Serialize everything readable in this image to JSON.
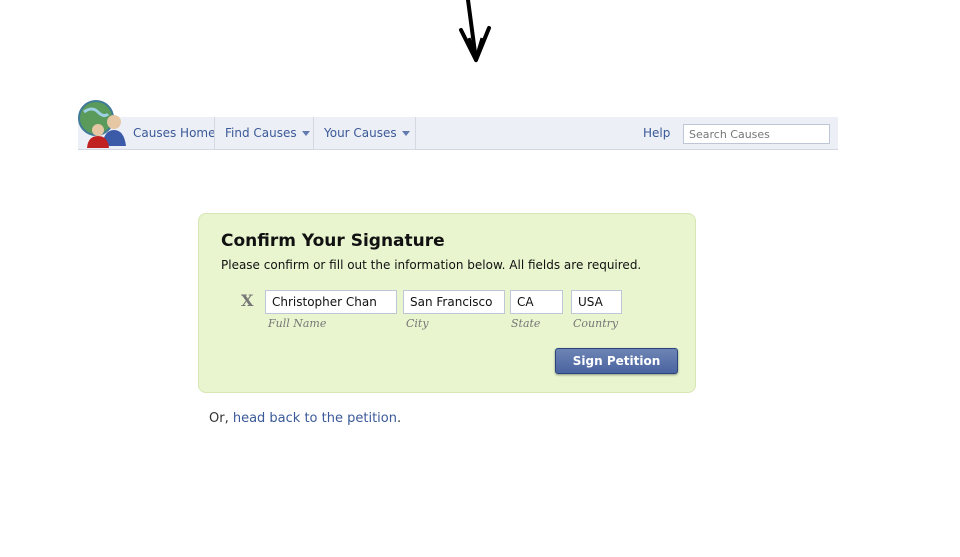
{
  "navbar": {
    "home_label": "Causes Home",
    "find_label": "Find Causes",
    "your_label": "Your Causes",
    "help_label": "Help",
    "search_placeholder": "Search Causes"
  },
  "signature": {
    "title": "Confirm Your Signature",
    "subtitle": "Please confirm or fill out the information below. All fields are required.",
    "clear_label": "X",
    "fields": [
      {
        "value": "Christopher Chan",
        "label": "Full Name"
      },
      {
        "value": "San Francisco",
        "label": "City"
      },
      {
        "value": "CA",
        "label": "State"
      },
      {
        "value": "USA",
        "label": "Country"
      }
    ],
    "submit_label": "Sign Petition"
  },
  "footer": {
    "prefix": "Or, ",
    "link_text": "head back to the petition",
    "suffix": "."
  },
  "colors": {
    "link": "#3b5998",
    "panel_bg": "#e9f5cf",
    "button": "#4a64a0"
  }
}
